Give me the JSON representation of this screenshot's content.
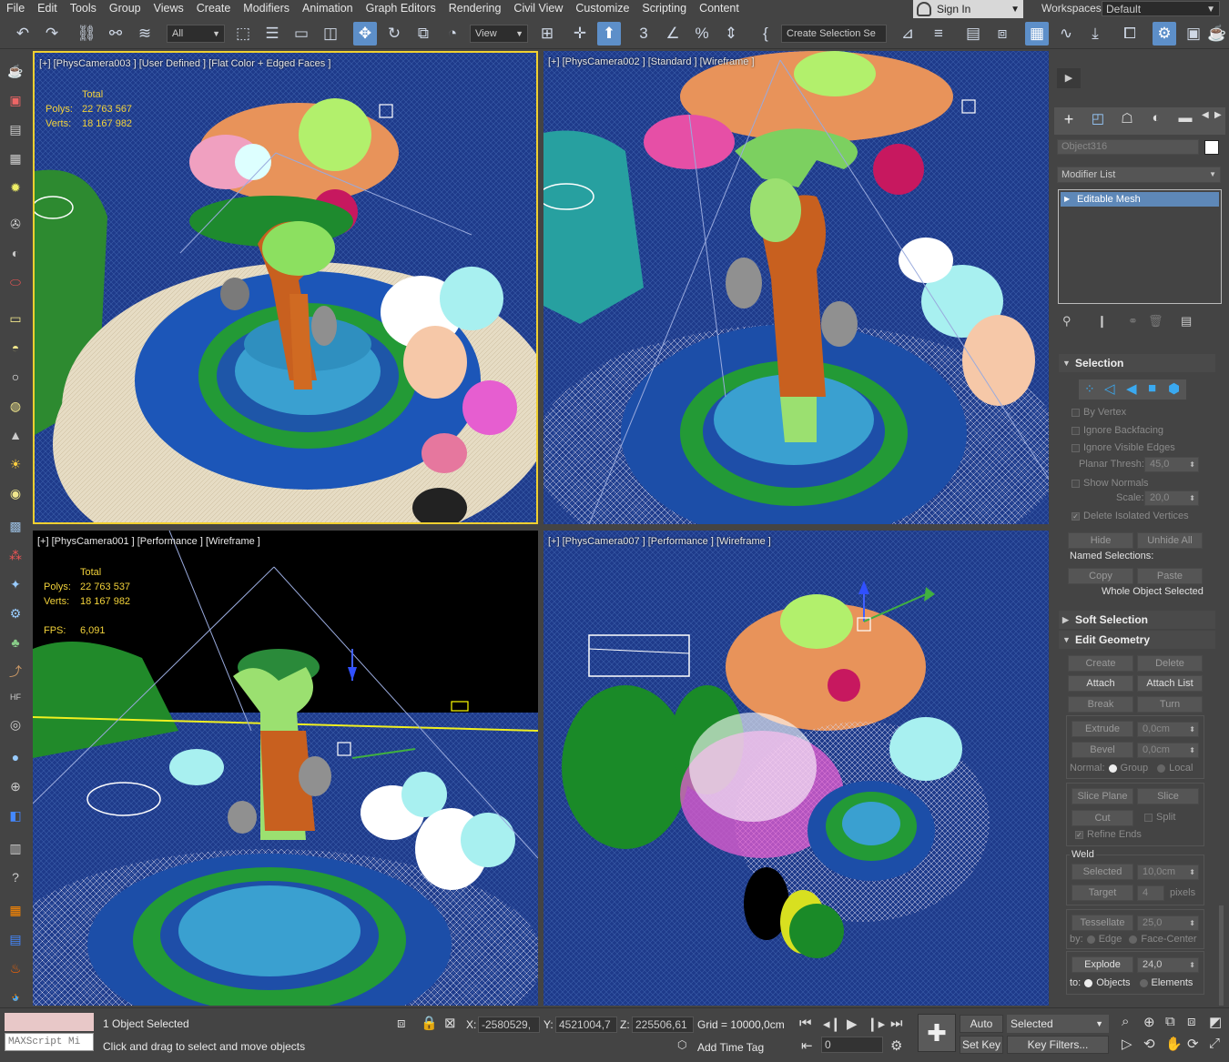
{
  "menu": {
    "items": [
      "File",
      "Edit",
      "Tools",
      "Group",
      "Views",
      "Create",
      "Modifiers",
      "Animation",
      "Graph Editors",
      "Rendering",
      "Civil View",
      "Customize",
      "Scripting",
      "Content"
    ],
    "sign_in": "Sign In",
    "workspaces_label": "Workspaces:",
    "workspace_value": "Default"
  },
  "toolbar": {
    "filter_value": "All",
    "coord_value": "View",
    "selection_set_placeholder": "Create Selection Se"
  },
  "viewports": {
    "top_left": {
      "label": "[+] [PhysCamera003 ] [User Defined ] [Flat Color + Edged Faces ]"
    },
    "top_right": {
      "label": "[+] [PhysCamera002 ] [Standard ] [Wireframe ]"
    },
    "bottom_left": {
      "label": "[+] [PhysCamera001 ] [Performance ] [Wireframe ]"
    },
    "bottom_right": {
      "label": "[+] [PhysCamera007 ] [Performance ] [Wireframe ]"
    }
  },
  "stats": {
    "total_label": "Total",
    "polys_label": "Polys:",
    "verts_label": "Verts:",
    "fps_label": "FPS:",
    "tl_polys": "22 763 567",
    "tl_verts": "18 167 982",
    "bl_polys": "22 763 537",
    "bl_verts": "18 167 982",
    "bl_fps": "6,091"
  },
  "command_panel": {
    "object_name": "Object316",
    "modifier_list": "Modifier List",
    "stack_item": "Editable Mesh",
    "selection": {
      "title": "Selection",
      "by_vertex": "By Vertex",
      "ignore_backfacing": "Ignore Backfacing",
      "ignore_visible_edges": "Ignore Visible Edges",
      "planar_thresh_label": "Planar Thresh:",
      "planar_thresh_value": "45,0",
      "show_normals": "Show Normals",
      "scale_label": "Scale:",
      "scale_value": "20,0",
      "delete_isolated": "Delete Isolated Vertices",
      "hide": "Hide",
      "unhide_all": "Unhide All",
      "named_selections": "Named Selections:",
      "copy": "Copy",
      "paste": "Paste",
      "whole_object": "Whole Object Selected"
    },
    "soft_selection": {
      "title": "Soft Selection"
    },
    "edit_geometry": {
      "title": "Edit Geometry",
      "create": "Create",
      "delete": "Delete",
      "attach": "Attach",
      "attach_list": "Attach List",
      "break": "Break",
      "turn": "Turn",
      "extrude": "Extrude",
      "extrude_value": "0,0cm",
      "bevel": "Bevel",
      "bevel_value": "0,0cm",
      "normal_label": "Normal:",
      "group": "Group",
      "local": "Local",
      "slice_plane": "Slice Plane",
      "slice": "Slice",
      "cut": "Cut",
      "split": "Split",
      "refine_ends": "Refine Ends",
      "weld_label": "Weld",
      "selected": "Selected",
      "selected_value": "10,0cm",
      "target": "Target",
      "target_value": "4",
      "pixels": "pixels",
      "tessellate": "Tessellate",
      "tessellate_value": "25,0",
      "by_label": "by:",
      "edge": "Edge",
      "face_center": "Face-Center",
      "explode": "Explode",
      "explode_value": "24,0",
      "to_label": "to:",
      "objects": "Objects",
      "elements": "Elements"
    }
  },
  "status": {
    "maxscript": "MAXScript Mi",
    "selected_count": "1 Object Selected",
    "prompt": "Click and drag to select and move objects",
    "x_label": "X:",
    "x_value": "-2580529,",
    "y_label": "Y:",
    "y_value": "4521004,7",
    "z_label": "Z:",
    "z_value": "225506,61",
    "grid": "Grid = 10000,0cm",
    "add_time_tag": "Add Time Tag",
    "frame_value": "0",
    "auto_key": "Auto Key",
    "set_key": "Set Key",
    "selected_filter": "Selected",
    "key_filters": "Key Filters..."
  }
}
